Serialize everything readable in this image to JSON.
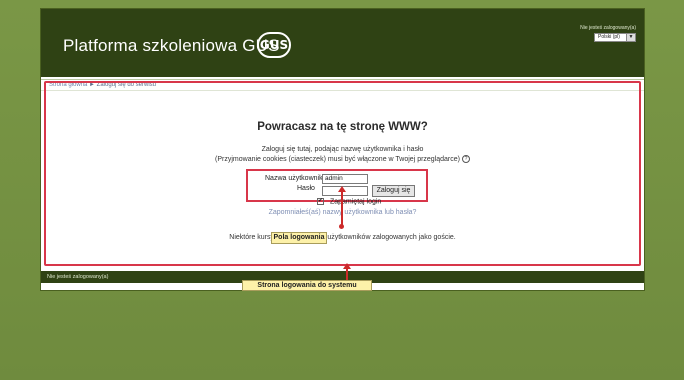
{
  "header": {
    "title": "Platforma szkoleniowa GUS",
    "logo_text": "GUS",
    "login_info": "Nie jesteś zalogowany(a)",
    "language": "Polski (pl)"
  },
  "breadcrumb": {
    "home": "Strona główna",
    "separator": "►",
    "current": "Zaloguj się do serwisu"
  },
  "login": {
    "heading": "Powracasz na tę stronę WWW?",
    "intro_line1": "Zaloguj się tutaj, podając nazwę użytkownika i hasło",
    "intro_line2": "(Przyjmowanie cookies (ciasteczek) musi być włączone w Twojej przeglądarce)",
    "help_icon": "?",
    "username_label": "Nazwa użytkownika",
    "username_value": "admin",
    "password_label": "Hasło",
    "login_button": "Zaloguj się",
    "remember_label": "Zapamiętaj login",
    "forgot_link": "Zapomniałeś(aś) nazwy użytkownika lub hasła?",
    "guest_note": "Niektóre kursy dostępne są dla użytkowników zalogowanych jako goście."
  },
  "annotations": {
    "fields_callout": "Pola logowania",
    "page_callout": "Strona logowania do systemu"
  },
  "footer": {
    "login_info": "Nie jesteś zalogowany(a)"
  },
  "colors": {
    "background": "#7b9848",
    "header": "#2f4214",
    "highlight": "#d8364a",
    "callout": "#fdf1a9"
  }
}
